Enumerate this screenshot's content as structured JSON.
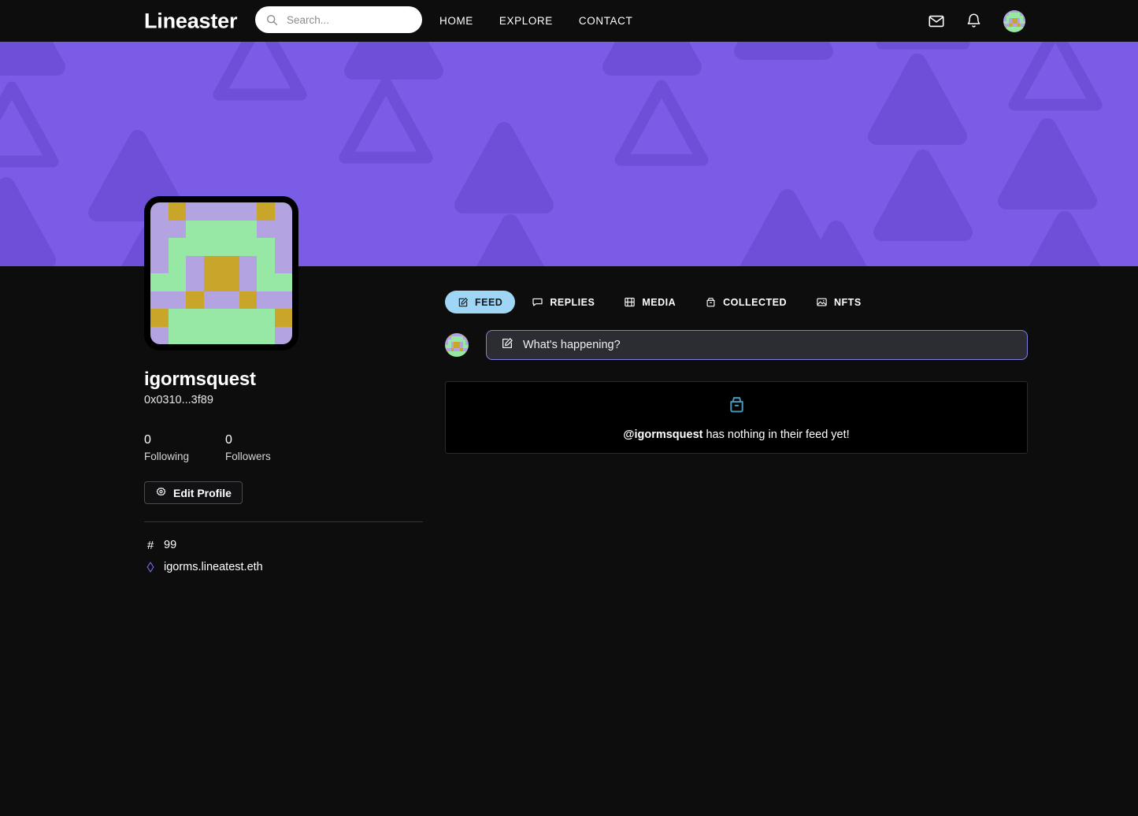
{
  "header": {
    "brand": "Lineaster",
    "search": {
      "placeholder": "Search...",
      "value": "",
      "icon": "search-icon"
    },
    "nav": [
      {
        "label": "HOME"
      },
      {
        "label": "EXPLORE"
      },
      {
        "label": "CONTACT"
      }
    ],
    "icons": [
      {
        "name": "mail-icon"
      },
      {
        "name": "bell-icon"
      }
    ],
    "avatar_alt": "user-avatar"
  },
  "banner": {
    "background_color": "#7b5ce6",
    "shape_color": "#6d4fd8",
    "motif": "triangle"
  },
  "profile": {
    "username": "igormsquest",
    "address": "0x0310...3f89",
    "stats": [
      {
        "count": "0",
        "label": "Following"
      },
      {
        "count": "0",
        "label": "Followers"
      }
    ],
    "edit_button": {
      "label": "Edit Profile",
      "icon": "gear-icon"
    },
    "meta": [
      {
        "icon": "hash-icon",
        "glyph": "#",
        "value": "99"
      },
      {
        "icon": "ethereum-diamond-icon",
        "value": "igorms.lineatest.eth"
      }
    ],
    "avatar_colors": {
      "purple": "#b3a3e0",
      "green": "#96e8a4",
      "gold": "#c9a62a"
    }
  },
  "tabs": [
    {
      "label": "FEED",
      "icon": "compose-icon",
      "active": true
    },
    {
      "label": "REPLIES",
      "icon": "chat-bubble-icon",
      "active": false
    },
    {
      "label": "MEDIA",
      "icon": "film-icon",
      "active": false
    },
    {
      "label": "COLLECTED",
      "icon": "archive-box-icon",
      "active": false
    },
    {
      "label": "NFTS",
      "icon": "image-icon",
      "active": false
    }
  ],
  "composer": {
    "placeholder": "What's happening?",
    "value": "",
    "icon": "compose-icon",
    "border_color": "#7d7fe0"
  },
  "empty_state": {
    "icon": "inbox-icon",
    "icon_color": "#4e93b8",
    "handle": "@igormsquest",
    "message": " has nothing in their feed yet!"
  },
  "theme": {
    "page_background": "#0d0d0d",
    "accent_blue": "#9fd5f5",
    "banner_purple": "#7b5ce6"
  }
}
